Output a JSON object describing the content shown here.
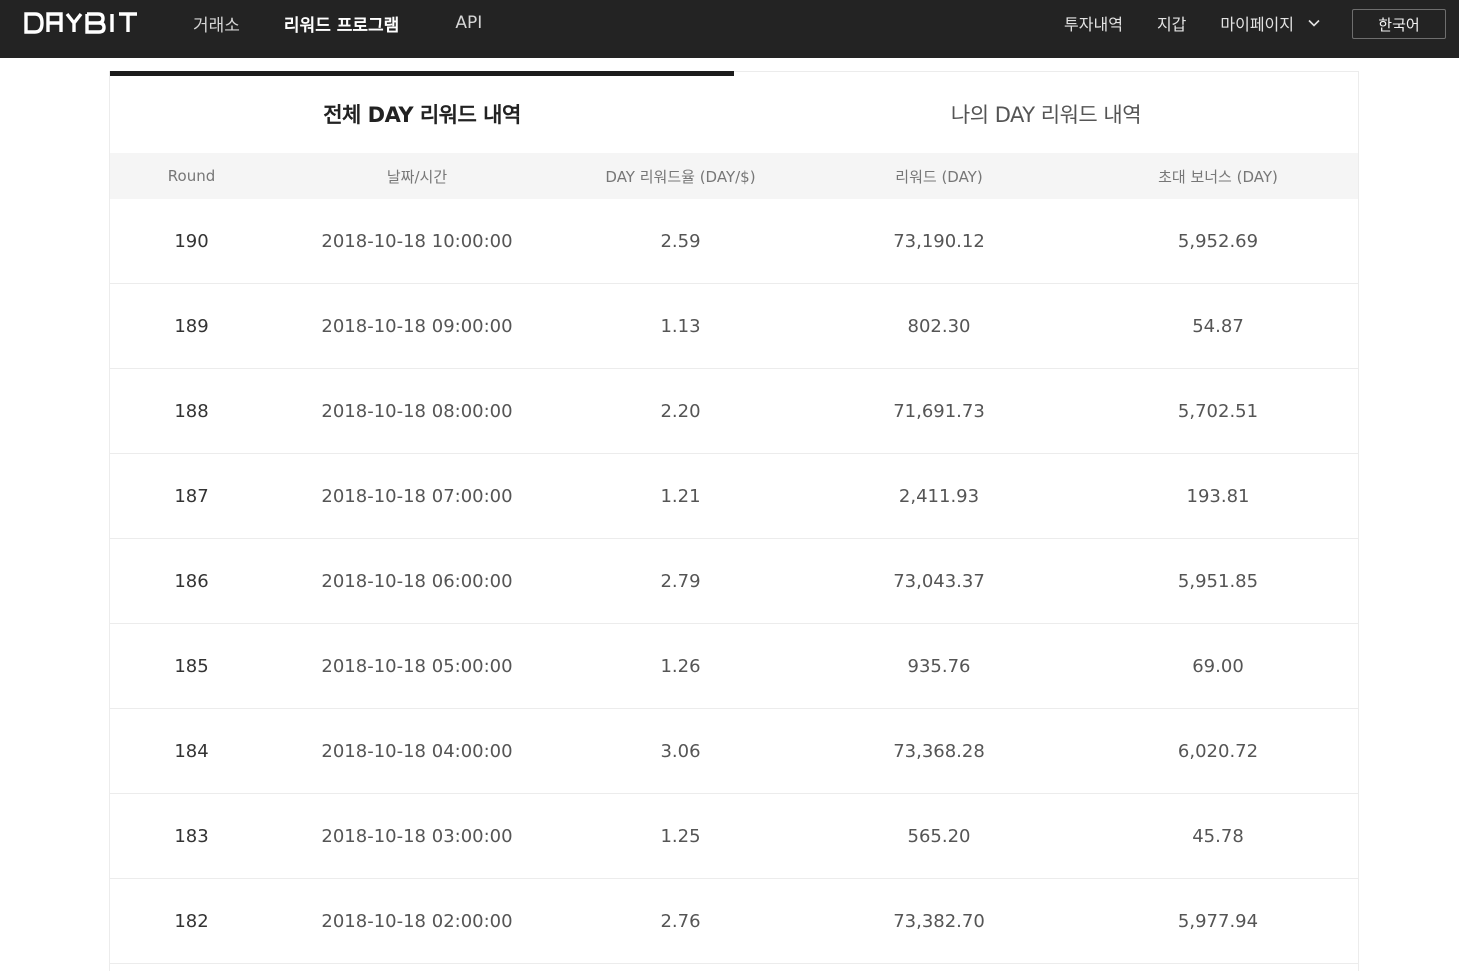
{
  "brand": {
    "logo_text": "DAYBIT"
  },
  "nav": {
    "left": [
      {
        "label": "거래소",
        "active": false
      },
      {
        "label": "리워드 프로그램",
        "active": true
      },
      {
        "label": "API",
        "active": false
      }
    ],
    "right": {
      "history": "투자내역",
      "wallet": "지갑",
      "mypage": "마이페이지",
      "language": "한국어"
    }
  },
  "tabs": [
    {
      "label": "전체 DAY 리워드 내역",
      "active": true
    },
    {
      "label": "나의 DAY 리워드 내역",
      "active": false
    }
  ],
  "table": {
    "headers": {
      "round": "Round",
      "datetime": "날짜/시간",
      "rate": "DAY 리워드율 (DAY/$)",
      "reward": "리워드 (DAY)",
      "bonus": "초대 보너스 (DAY)"
    },
    "rows": [
      {
        "round": "190",
        "datetime": "2018-10-18 10:00:00",
        "rate": "2.59",
        "reward": "73,190.12",
        "bonus": "5,952.69"
      },
      {
        "round": "189",
        "datetime": "2018-10-18 09:00:00",
        "rate": "1.13",
        "reward": "802.30",
        "bonus": "54.87"
      },
      {
        "round": "188",
        "datetime": "2018-10-18 08:00:00",
        "rate": "2.20",
        "reward": "71,691.73",
        "bonus": "5,702.51"
      },
      {
        "round": "187",
        "datetime": "2018-10-18 07:00:00",
        "rate": "1.21",
        "reward": "2,411.93",
        "bonus": "193.81"
      },
      {
        "round": "186",
        "datetime": "2018-10-18 06:00:00",
        "rate": "2.79",
        "reward": "73,043.37",
        "bonus": "5,951.85"
      },
      {
        "round": "185",
        "datetime": "2018-10-18 05:00:00",
        "rate": "1.26",
        "reward": "935.76",
        "bonus": "69.00"
      },
      {
        "round": "184",
        "datetime": "2018-10-18 04:00:00",
        "rate": "3.06",
        "reward": "73,368.28",
        "bonus": "6,020.72"
      },
      {
        "round": "183",
        "datetime": "2018-10-18 03:00:00",
        "rate": "1.25",
        "reward": "565.20",
        "bonus": "45.78"
      },
      {
        "round": "182",
        "datetime": "2018-10-18 02:00:00",
        "rate": "2.76",
        "reward": "73,382.70",
        "bonus": "5,977.94"
      }
    ]
  },
  "colors": {
    "nav_bg": "#232323",
    "header_bg": "#f5f5f5",
    "active_tab_bar": "#1c1c1c"
  },
  "icons": {
    "mypage_dropdown": "chevron-down-icon"
  }
}
